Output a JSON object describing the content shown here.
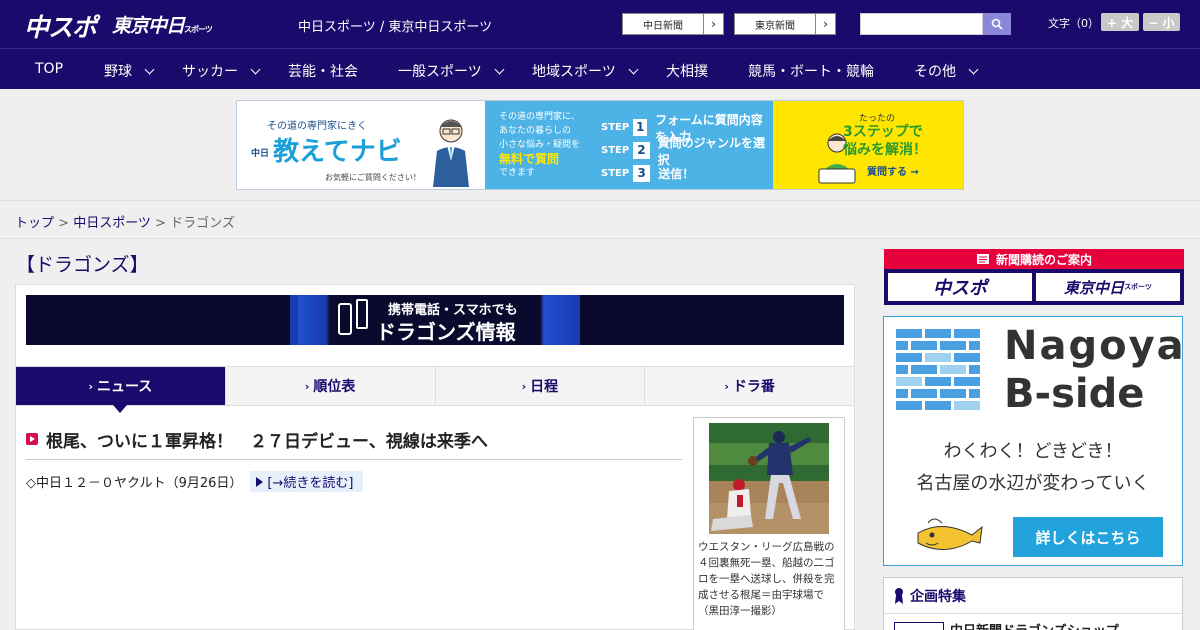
{
  "header": {
    "logo_main": "中スポ",
    "logo_sub": "東京中日",
    "logo_sub_small": "スポーツ",
    "site_title": "中日スポーツ / 東京中日スポーツ",
    "ext_links": [
      {
        "label": "中日新聞"
      },
      {
        "label": "東京新聞"
      }
    ],
    "search_placeholder": "",
    "font_size_label": "文字（0）",
    "font_plus": "+ 大",
    "font_minus": "− 小"
  },
  "nav": {
    "items": [
      {
        "label": "TOP",
        "dropdown": false
      },
      {
        "label": "野球",
        "dropdown": true
      },
      {
        "label": "サッカー",
        "dropdown": true
      },
      {
        "label": "芸能・社会",
        "dropdown": false
      },
      {
        "label": "一般スポーツ",
        "dropdown": true
      },
      {
        "label": "地域スポーツ",
        "dropdown": true
      },
      {
        "label": "大相撲",
        "dropdown": false
      },
      {
        "label": "競馬・ボート・競輪",
        "dropdown": false
      },
      {
        "label": "その他",
        "dropdown": true
      }
    ]
  },
  "ad_banner": {
    "sub": "その道の専門家にきく",
    "brand_small": "中日",
    "brand": "教えてナビ",
    "note": "お気軽にご質問ください！",
    "desc_l1": "その道の専門家に、",
    "desc_l2": "あなたの暮らしの",
    "desc_l3": "小さな悩み・疑問を",
    "desc_hl": "無料で質問",
    "desc_l4": "できます",
    "steps": [
      {
        "label": "STEP",
        "num": "1",
        "text": "フォームに質問内容を入力"
      },
      {
        "label": "STEP",
        "num": "2",
        "text": "質問のジャンルを選択"
      },
      {
        "label": "STEP",
        "num": "3",
        "text": "送信！"
      }
    ],
    "right_l1": "たったの",
    "right_l2": "3ステップで",
    "right_l3": "悩みを解消！",
    "right_cta": "質問する →"
  },
  "breadcrumb": {
    "top": "トップ",
    "section": "中日スポーツ",
    "current": "ドラゴンズ",
    "sep": " > "
  },
  "page_title": "【ドラゴンズ】",
  "mobile_banner": {
    "line1": "携帯電話・スマホでも",
    "line2": "ドラゴンズ情報"
  },
  "tabs": [
    {
      "label": "ニュース",
      "active": true
    },
    {
      "label": "順位表",
      "active": false
    },
    {
      "label": "日程",
      "active": false
    },
    {
      "label": "ドラ番",
      "active": false
    }
  ],
  "article": {
    "headline": "根尾、ついに１軍昇格！　２７日デビュー、視線は来季へ",
    "summary": "◇中日１２－０ヤクルト（9月26日）",
    "read_more": "[→続きを読む]",
    "photo_caption": "ウエスタン・リーグ広島戦の４回裏無死一塁、船越の二ゴロを一塁へ送球し、併殺を完成させる根尾＝由宇球場で（黒田淳一撮影）"
  },
  "sidebar": {
    "subscribe_head": "新聞購読のご案内",
    "sub_logo1": "中スポ",
    "sub_logo2": "東京中日",
    "sub_logo2_small": "スポーツ",
    "bside_t1": "Nagoya",
    "bside_t2": "B-side",
    "bside_c1": "わくわく！どきどき！",
    "bside_c2": "名古屋の水辺が変わっていく",
    "bside_btn": "詳しくはこちら",
    "kikaku_head": "企画特集",
    "kikaku_item": "中日新聞ドラゴンズショップ"
  },
  "colors": {
    "brand_navy": "#1a0a6b",
    "accent_red": "#e6003c",
    "accent_blue": "#22a3dc"
  }
}
